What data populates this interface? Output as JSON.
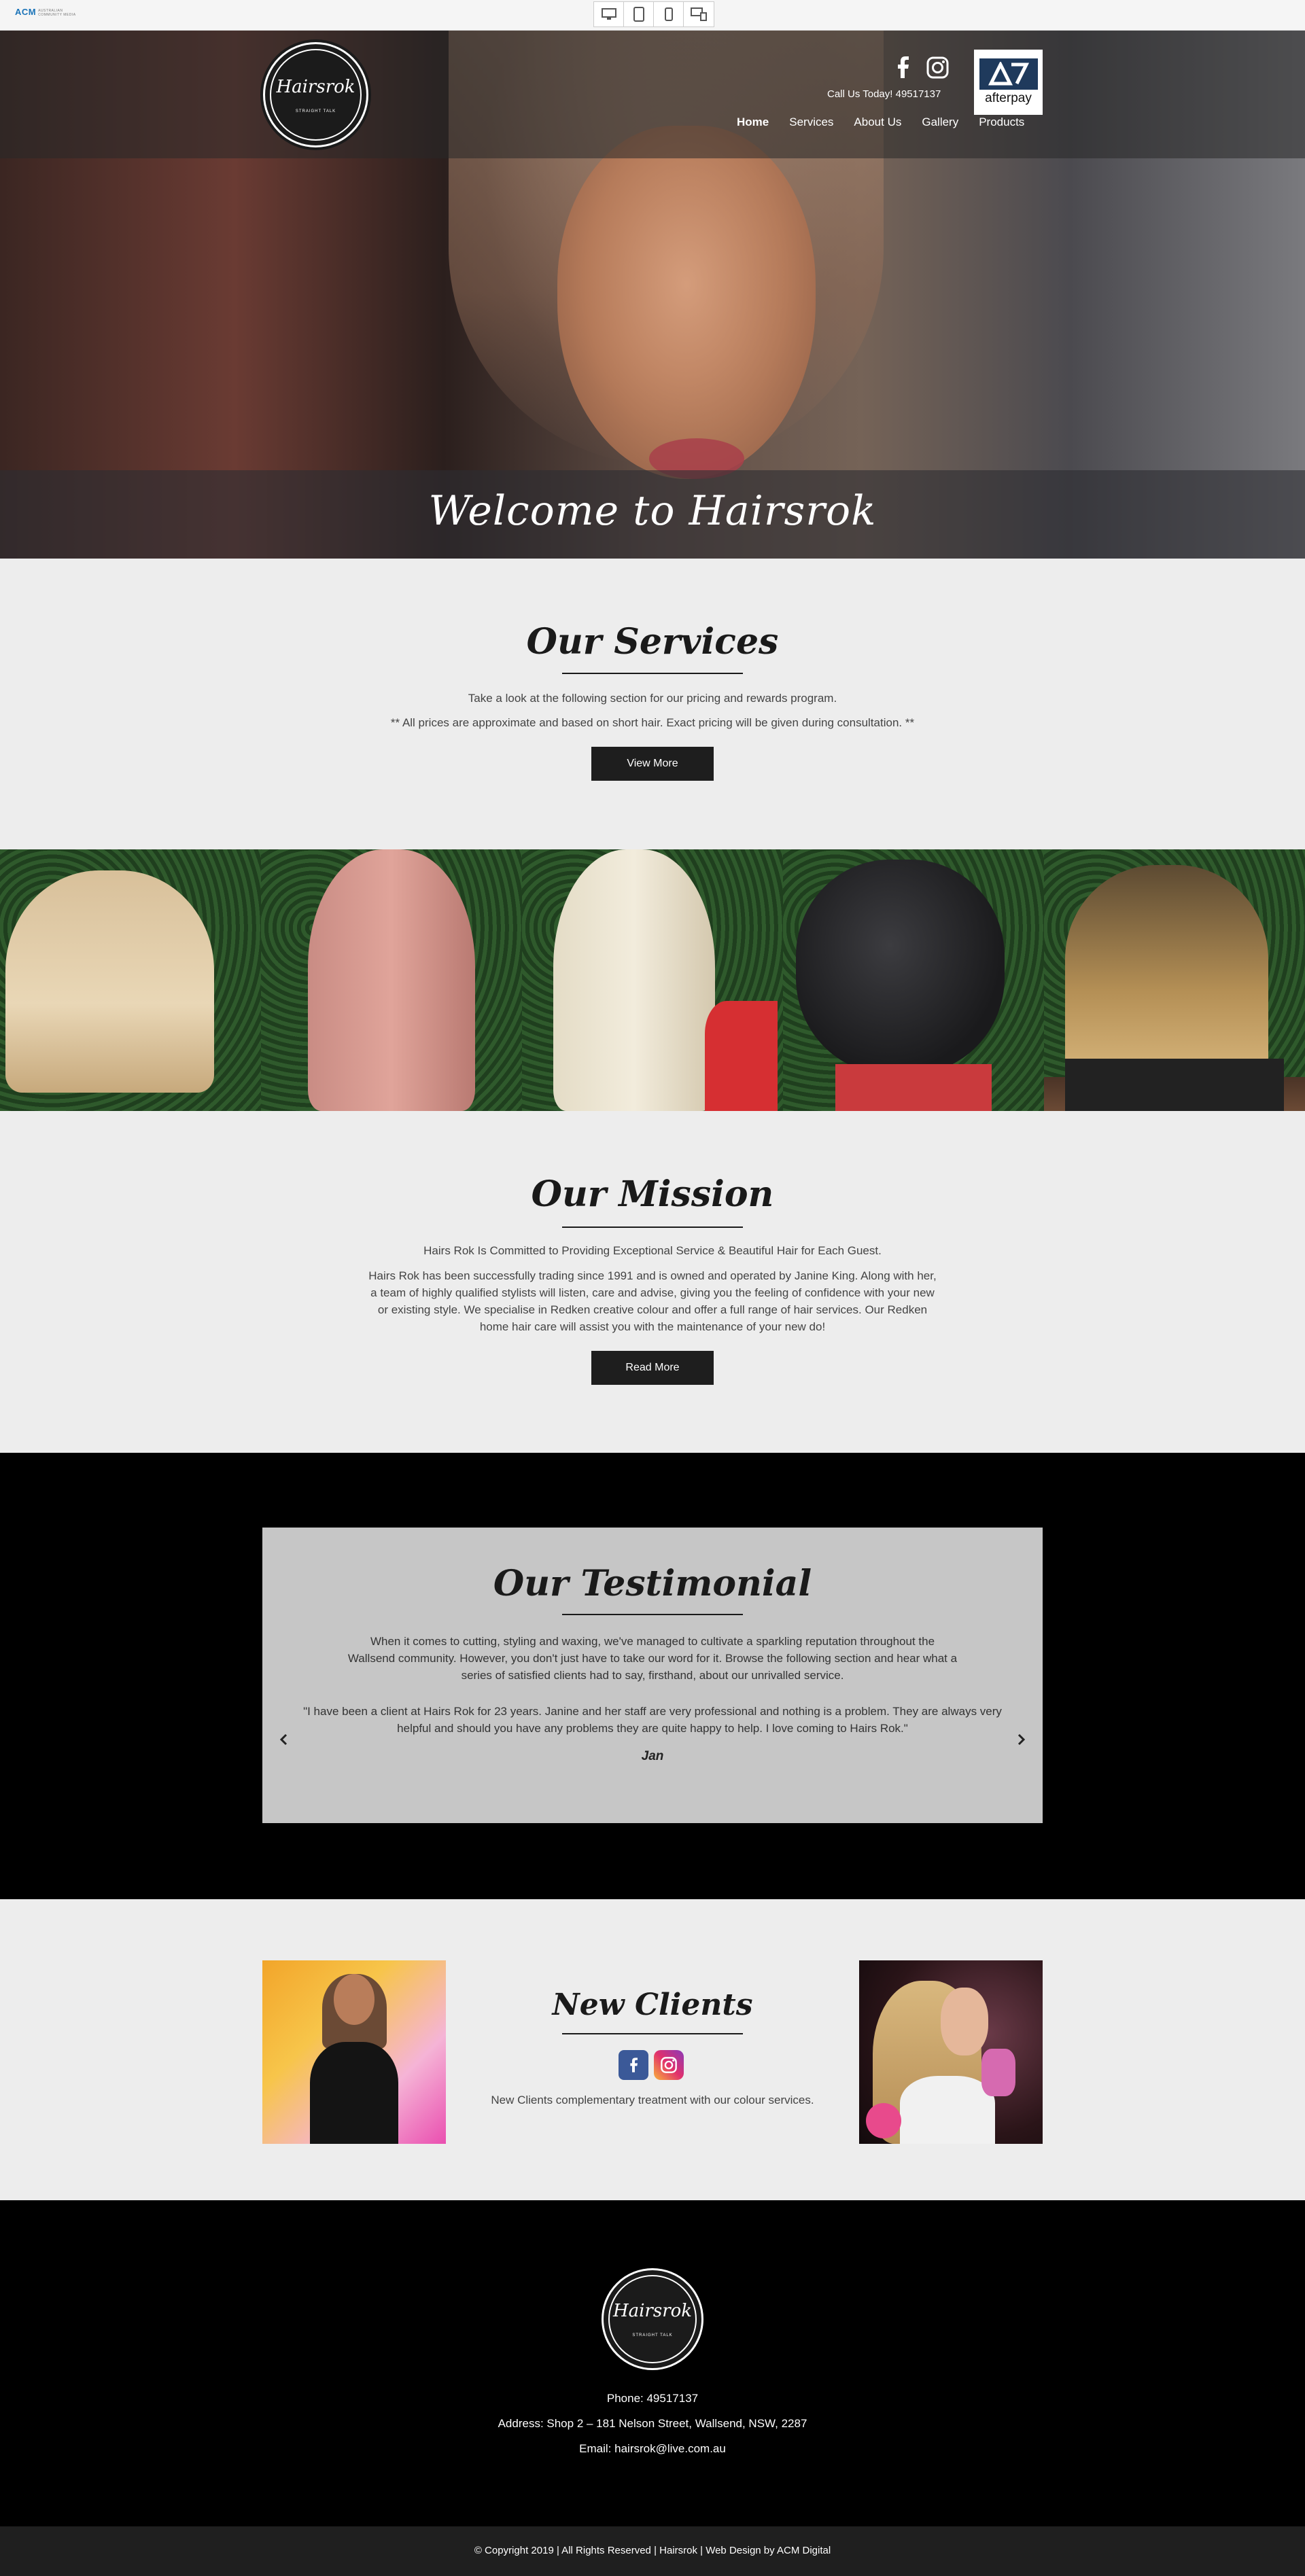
{
  "preview_bar": {
    "acm_logo": "ACM",
    "acm_sub": "AUSTRALIAN COMMUNITY MEDIA",
    "devices": [
      "desktop-icon",
      "tablet-icon",
      "mobile-icon",
      "multi-device-icon"
    ]
  },
  "header": {
    "logo_text": "Hairsrok",
    "logo_small": "STRAIGHT TALK",
    "call": "Call Us Today! 49517137",
    "afterpay_label": "afterpay",
    "nav": [
      "Home",
      "Services",
      "About Us",
      "Gallery",
      "Products"
    ],
    "active_nav": "Home"
  },
  "hero": {
    "title": "Welcome to Hairsrok"
  },
  "services": {
    "title": "Our Services",
    "line1": "Take a look at the following section for our pricing and rewards program.",
    "line2": "** All prices are approximate and based on short hair. Exact pricing will be given during consultation. **",
    "button": "View More"
  },
  "mission": {
    "title": "Our Mission",
    "lead": "Hairs Rok Is Committed to Providing Exceptional Service & Beautiful Hair for Each Guest.",
    "body": "Hairs Rok has been successfully trading since 1991 and is owned and operated by Janine King. Along with her, a team of highly qualified stylists will listen, care and advise, giving you the feeling of confidence with your new or existing style. We specialise in Redken creative colour and offer a full range of hair services. Our Redken home hair care will assist you with the maintenance of your new do!",
    "button": "Read More"
  },
  "testimonial": {
    "title": "Our Testimonial",
    "intro": "When it comes to cutting, styling and waxing, we've managed to cultivate a sparkling reputation throughout the Wallsend community. However, you don't just have to take our word for it. Browse the following section and hear what a series of satisfied clients had to say, firsthand, about our unrivalled service.",
    "quote": "\"I have been a client at Hairs Rok for 23 years. Janine and her staff are very professional and nothing is a problem. They are always very helpful and should you have any problems they are quite happy to help. I love coming to Hairs Rok.\"",
    "author": "Jan"
  },
  "new_clients": {
    "title": "New Clients",
    "text": "New Clients complementary treatment with our colour services."
  },
  "footer": {
    "phone": "Phone: 49517137",
    "address": "Address: Shop 2 – 181 Nelson Street, Wallsend, NSW, 2287",
    "email": "Email: hairsrok@live.com.au",
    "copyright": "© Copyright 2019 | All Rights Reserved | Hairsrok | Web Design by ACM Digital"
  }
}
